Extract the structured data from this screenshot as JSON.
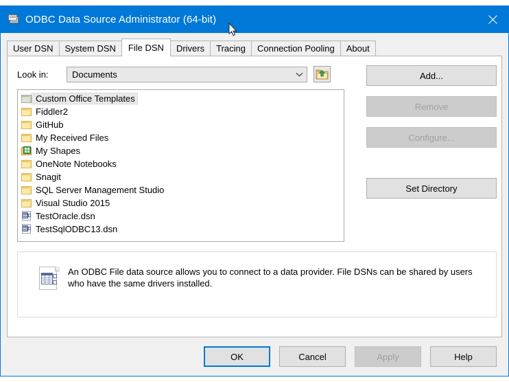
{
  "window": {
    "title": "ODBC Data Source Administrator (64-bit)",
    "app_icon": "database-icon",
    "close_icon": "close-icon",
    "accent_color": "#0078d7",
    "titlebar_color": "#0078d7",
    "cursor_icon": "arrow-cursor"
  },
  "tabs": [
    {
      "label": "User DSN",
      "active": false
    },
    {
      "label": "System DSN",
      "active": false
    },
    {
      "label": "File DSN",
      "active": true
    },
    {
      "label": "Drivers",
      "active": false
    },
    {
      "label": "Tracing",
      "active": false
    },
    {
      "label": "Connection Pooling",
      "active": false
    },
    {
      "label": "About",
      "active": false
    }
  ],
  "lookin": {
    "label": "Look in:",
    "value": "Documents",
    "dropdown_icon": "chevron-down-icon",
    "uplevel_icon": "up-one-level-folder-icon"
  },
  "file_list": {
    "folders": [
      {
        "name": "Custom Office Templates",
        "icon": "folder-icon-office",
        "selected": true
      },
      {
        "name": "Fiddler2",
        "icon": "folder-icon",
        "selected": false
      },
      {
        "name": "GitHub",
        "icon": "folder-icon",
        "selected": false
      },
      {
        "name": "My Received Files",
        "icon": "folder-icon",
        "selected": false
      },
      {
        "name": "My Shapes",
        "icon": "folder-icon-visio",
        "selected": false
      },
      {
        "name": "OneNote Notebooks",
        "icon": "folder-icon",
        "selected": false
      },
      {
        "name": "Snagit",
        "icon": "folder-icon",
        "selected": false
      },
      {
        "name": "SQL Server Management Studio",
        "icon": "folder-icon",
        "selected": false
      },
      {
        "name": "Visual Studio 2015",
        "icon": "folder-icon",
        "selected": false
      }
    ],
    "files": [
      {
        "name": "TestOracle.dsn",
        "icon": "dsn-file-icon"
      },
      {
        "name": "TestSqlODBC13.dsn",
        "icon": "dsn-file-icon"
      }
    ]
  },
  "side_buttons": {
    "add": {
      "label": "Add...",
      "enabled": true
    },
    "remove": {
      "label": "Remove",
      "enabled": false
    },
    "configure": {
      "label": "Configure...",
      "enabled": false
    },
    "set_directory": {
      "label": "Set Directory",
      "enabled": true
    }
  },
  "description": {
    "icon": "dsn-document-icon",
    "text": "An ODBC File data source allows you to connect to a data provider.  File DSNs can be shared by users who have the same drivers installed."
  },
  "bottom_buttons": {
    "ok": {
      "label": "OK",
      "enabled": true,
      "default": true
    },
    "cancel": {
      "label": "Cancel",
      "enabled": true,
      "default": false
    },
    "apply": {
      "label": "Apply",
      "enabled": false,
      "default": false
    },
    "help": {
      "label": "Help",
      "enabled": true,
      "default": false
    }
  }
}
